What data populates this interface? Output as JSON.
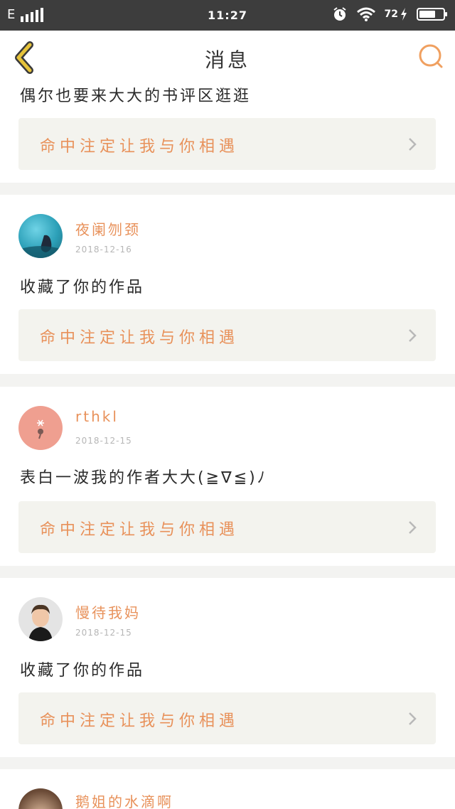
{
  "status_bar": {
    "network": "E",
    "time": "11:27",
    "battery": "72",
    "battery_level": 0.72,
    "icons": [
      "signal-icon",
      "alarm-icon",
      "wifi-icon",
      "charging-icon",
      "battery-icon"
    ]
  },
  "header": {
    "title": "消息",
    "back_icon": "back-chevron-icon",
    "search_icon": "search-icon",
    "accent": "#f0a060"
  },
  "colors": {
    "name": "#e8915a",
    "link_bg": "#f3f3ee",
    "divider_bg": "#f3f3f1",
    "back_icon": "#e6c33a"
  },
  "feed": {
    "items": [
      {
        "message": "偶尔也要来大大的书评区逛逛",
        "work_title": "命中注定让我与你相遇"
      },
      {
        "name": "夜阑刎颈",
        "date": "2018-12-16",
        "message": "收藏了你的作品",
        "work_title": "命中注定让我与你相遇"
      },
      {
        "name": "rthkl",
        "date": "2018-12-15",
        "message": "表白一波我的作者大大(≧∇≦)ﾉ",
        "work_title": "命中注定让我与你相遇"
      },
      {
        "name": "慢待我妈",
        "date": "2018-12-15",
        "message": "收藏了你的作品",
        "work_title": "命中注定让我与你相遇"
      },
      {
        "name": "鹅姐的水滴啊"
      }
    ]
  }
}
